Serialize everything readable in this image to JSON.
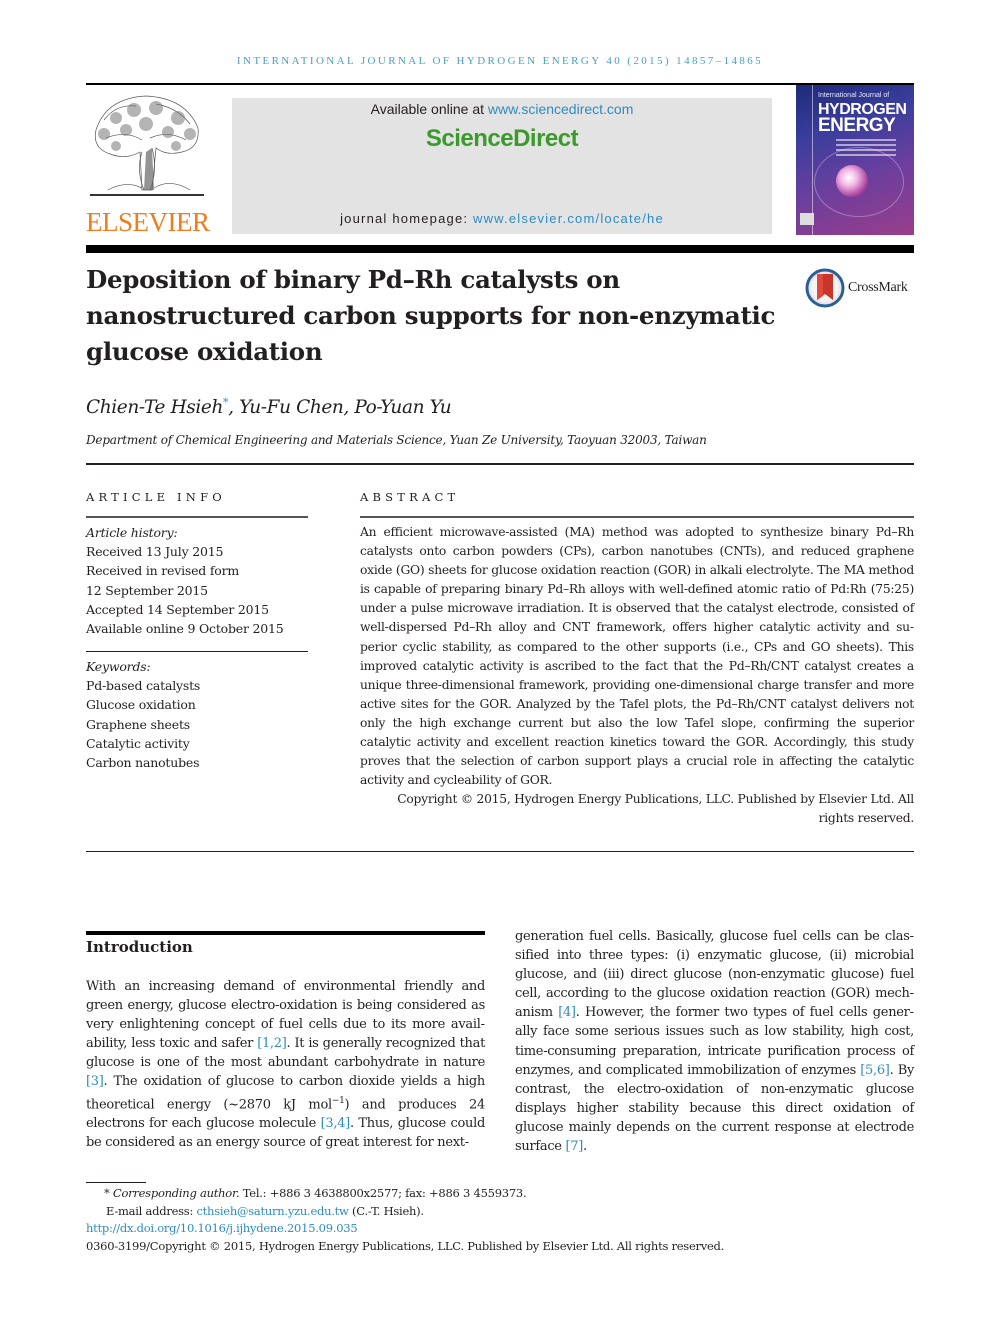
{
  "running_head": {
    "journal": "International Journal of Hydrogen Energy 40",
    "year_pages": "(2015) 14857–14865"
  },
  "publisher": {
    "logo_wordmark": "ELSEVIER",
    "available_prefix": "Available online at ",
    "available_link": "www.sciencedirect.com",
    "brand": "ScienceDirect",
    "homepage_prefix": "journal homepage: ",
    "homepage_link": "www.elsevier.com/locate/he",
    "brand_color": "#3a9b2a",
    "link_color": "#2e8bbf",
    "elsevier_color": "#f07c1a"
  },
  "cover": {
    "line1": "International Journal of",
    "line2": "HYDROGEN",
    "line3": "ENERGY"
  },
  "article": {
    "title": "Deposition of binary Pd–Rh catalysts on nanostructured carbon supports for non-enzymatic glucose oxidation",
    "crossmark_label": "CrossMark",
    "authors": [
      {
        "name": "Chien-Te Hsieh",
        "mark": "*"
      },
      {
        "name": "Yu-Fu Chen",
        "mark": ""
      },
      {
        "name": "Po-Yuan Yu",
        "mark": ""
      }
    ],
    "author_sep": ", ",
    "affiliation": "Department of Chemical Engineering and Materials Science, Yuan Ze University, Taoyuan 32003, Taiwan"
  },
  "article_info": {
    "heading": "ARTICLE INFO",
    "history_label": "Article history:",
    "history": [
      "Received 13 July 2015",
      "Received in revised form",
      "12 September 2015",
      "Accepted 14 September 2015",
      "Available online 9 October 2015"
    ],
    "keywords_label": "Keywords:",
    "keywords": [
      "Pd-based catalysts",
      "Glucose oxidation",
      "Graphene sheets",
      "Catalytic activity",
      "Carbon nanotubes"
    ]
  },
  "abstract": {
    "heading": "ABSTRACT",
    "text": "An efficient microwave-assisted (MA) method was adopted to synthesize binary Pd–Rh catalysts onto carbon powders (CPs), carbon nanotubes (CNTs), and reduced graphene oxide (GO) sheets for glucose oxidation reaction (GOR) in alkali electrolyte. The MA method is capable of preparing binary Pd–Rh alloys with well-defined atomic ratio of Pd:Rh (75:25) under a pulse microwave irradiation. It is observed that the catalyst electrode, consisted of well-dispersed Pd–Rh alloy and CNT framework, offers higher catalytic activity and su­perior cyclic stability, as compared to the other supports (i.e., CPs and GO sheets). This improved catalytic activity is ascribed to the fact that the Pd–Rh/CNT catalyst creates a unique three-dimensional framework, providing one-dimensional charge transfer and more active sites for the GOR. Analyzed by the Tafel plots, the Pd–Rh/CNT catalyst delivers not only the high exchange current but also the low Tafel slope, confirming the superior catalytic activity and excellent reaction kinetics toward the GOR. Accordingly, this study proves that the selection of carbon support plays a crucial role in affecting the catalytic activity and cycleability of GOR.",
    "copyright": "Copyright © 2015, Hydrogen Energy Publications, LLC. Published by Elsevier Ltd. All rights reserved."
  },
  "introduction": {
    "heading": "Introduction",
    "left_parts": [
      {
        "t": "With an increasing demand of environmental friendly and green energy, glucose electro-oxidation is being considered as very enlightening concept of fuel cells due to its more avail­ability, less toxic and safer ",
        "cite": false
      },
      {
        "t": "[1,2]",
        "cite": true
      },
      {
        "t": ". It is generally recognized that glucose is one of the most abundant carbohydrate in nature ",
        "cite": false
      },
      {
        "t": "[3]",
        "cite": true
      },
      {
        "t": ". The oxidation of glucose to carbon dioxide yields a high theoretical energy (~2870 kJ mol",
        "cite": false
      },
      {
        "t": "−1",
        "sup": true
      },
      {
        "t": ") and produces 24 electrons for each glucose molecule ",
        "cite": false
      },
      {
        "t": "[3,4]",
        "cite": true
      },
      {
        "t": ". Thus, glucose could be considered as an energy source of great interest for next-",
        "cite": false
      }
    ],
    "right_parts": [
      {
        "t": "generation fuel cells. Basically, glucose fuel cells can be clas­sified into three types: (i) enzymatic glucose, (ii) microbial glucose, and (iii) direct glucose (non-enzymatic glucose) fuel cell, according to the glucose oxidation reaction (GOR) mech­anism ",
        "cite": false
      },
      {
        "t": "[4]",
        "cite": true
      },
      {
        "t": ". However, the former two types of fuel cells gener­ally face some serious issues such as low stability, high cost, time-consuming preparation, intricate purification process of enzymes, and complicated immobilization of enzymes ",
        "cite": false
      },
      {
        "t": "[5,6]",
        "cite": true
      },
      {
        "t": ". By contrast, the electro-oxidation of non-enzymatic glucose displays higher stability because this direct oxidation of glucose mainly depends on the current response at electrode surface ",
        "cite": false
      },
      {
        "t": "[7]",
        "cite": true
      },
      {
        "t": ".",
        "cite": false
      }
    ]
  },
  "footnotes": {
    "corresponding_label": "Corresponding author.",
    "corresponding_mark": "*",
    "contact": " Tel.: +886 3 4638800x2577; fax: +886 3 4559373.",
    "email_prefix": "E-mail address: ",
    "email": "cthsieh@saturn.yzu.edu.tw",
    "email_suffix": " (C.-T. Hsieh).",
    "doi": "http://dx.doi.org/10.1016/j.ijhydene.2015.09.035",
    "issn_copyright": "0360-3199/Copyright © 2015, Hydrogen Energy Publications, LLC. Published by Elsevier Ltd. All rights reserved."
  }
}
